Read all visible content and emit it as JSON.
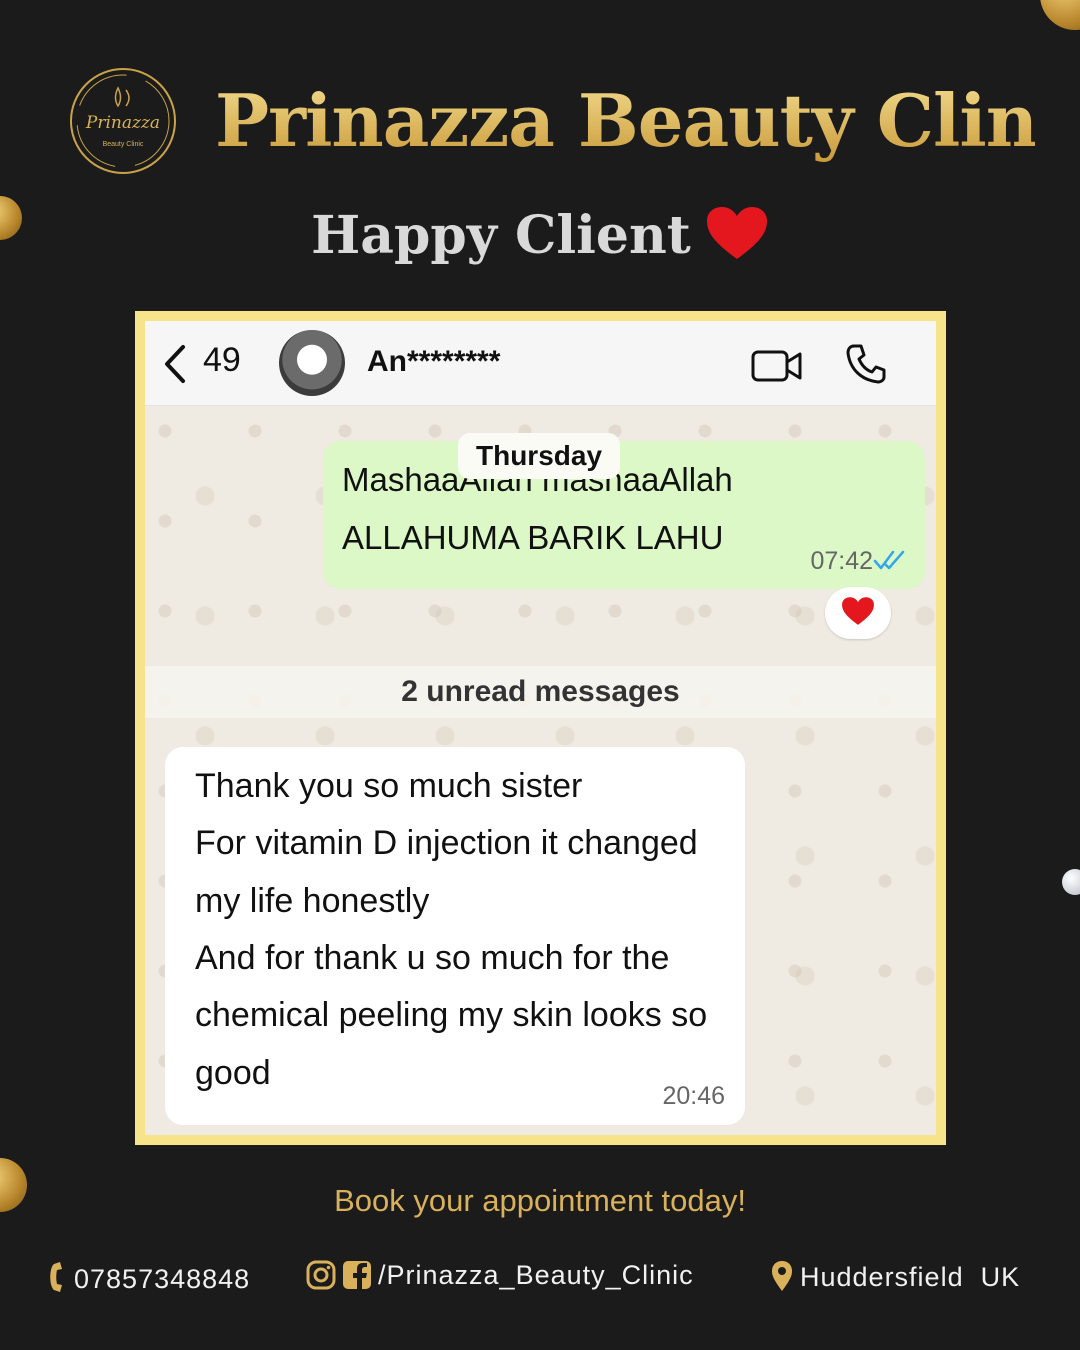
{
  "brand": {
    "name": "Prinazza Beauty Clinic",
    "logo_text": "Prinazza",
    "logo_sub": "Beauty Clinic"
  },
  "subtitle": "Happy Client",
  "chat": {
    "header": {
      "back_count": "49",
      "contact_name": "An********"
    },
    "day_label": "Thursday",
    "outgoing": {
      "lines": [
        "MashaaAllah mashaaAllah",
        "ALLAHUMA BARIK LAHU"
      ],
      "time": "07:42",
      "reaction": "heart"
    },
    "unread_banner": "2 unread messages",
    "incoming": {
      "lines": [
        "Thank you so much sister",
        "For vitamin D injection it changed",
        "my life honestly",
        "And for thank u so much for the",
        "chemical peeling my skin looks so",
        "good"
      ],
      "time": "20:46"
    }
  },
  "cta": "Book your appointment today!",
  "footer": {
    "phone": "07857348848",
    "social": "/Prinazza_Beauty_Clinic",
    "location": "Huddersfield  UK"
  },
  "colors": {
    "gold": "#e2bf63",
    "frame": "#f7e38a",
    "outgoing_bubble": "#dcf8c6",
    "background": "#1b1b1b"
  }
}
